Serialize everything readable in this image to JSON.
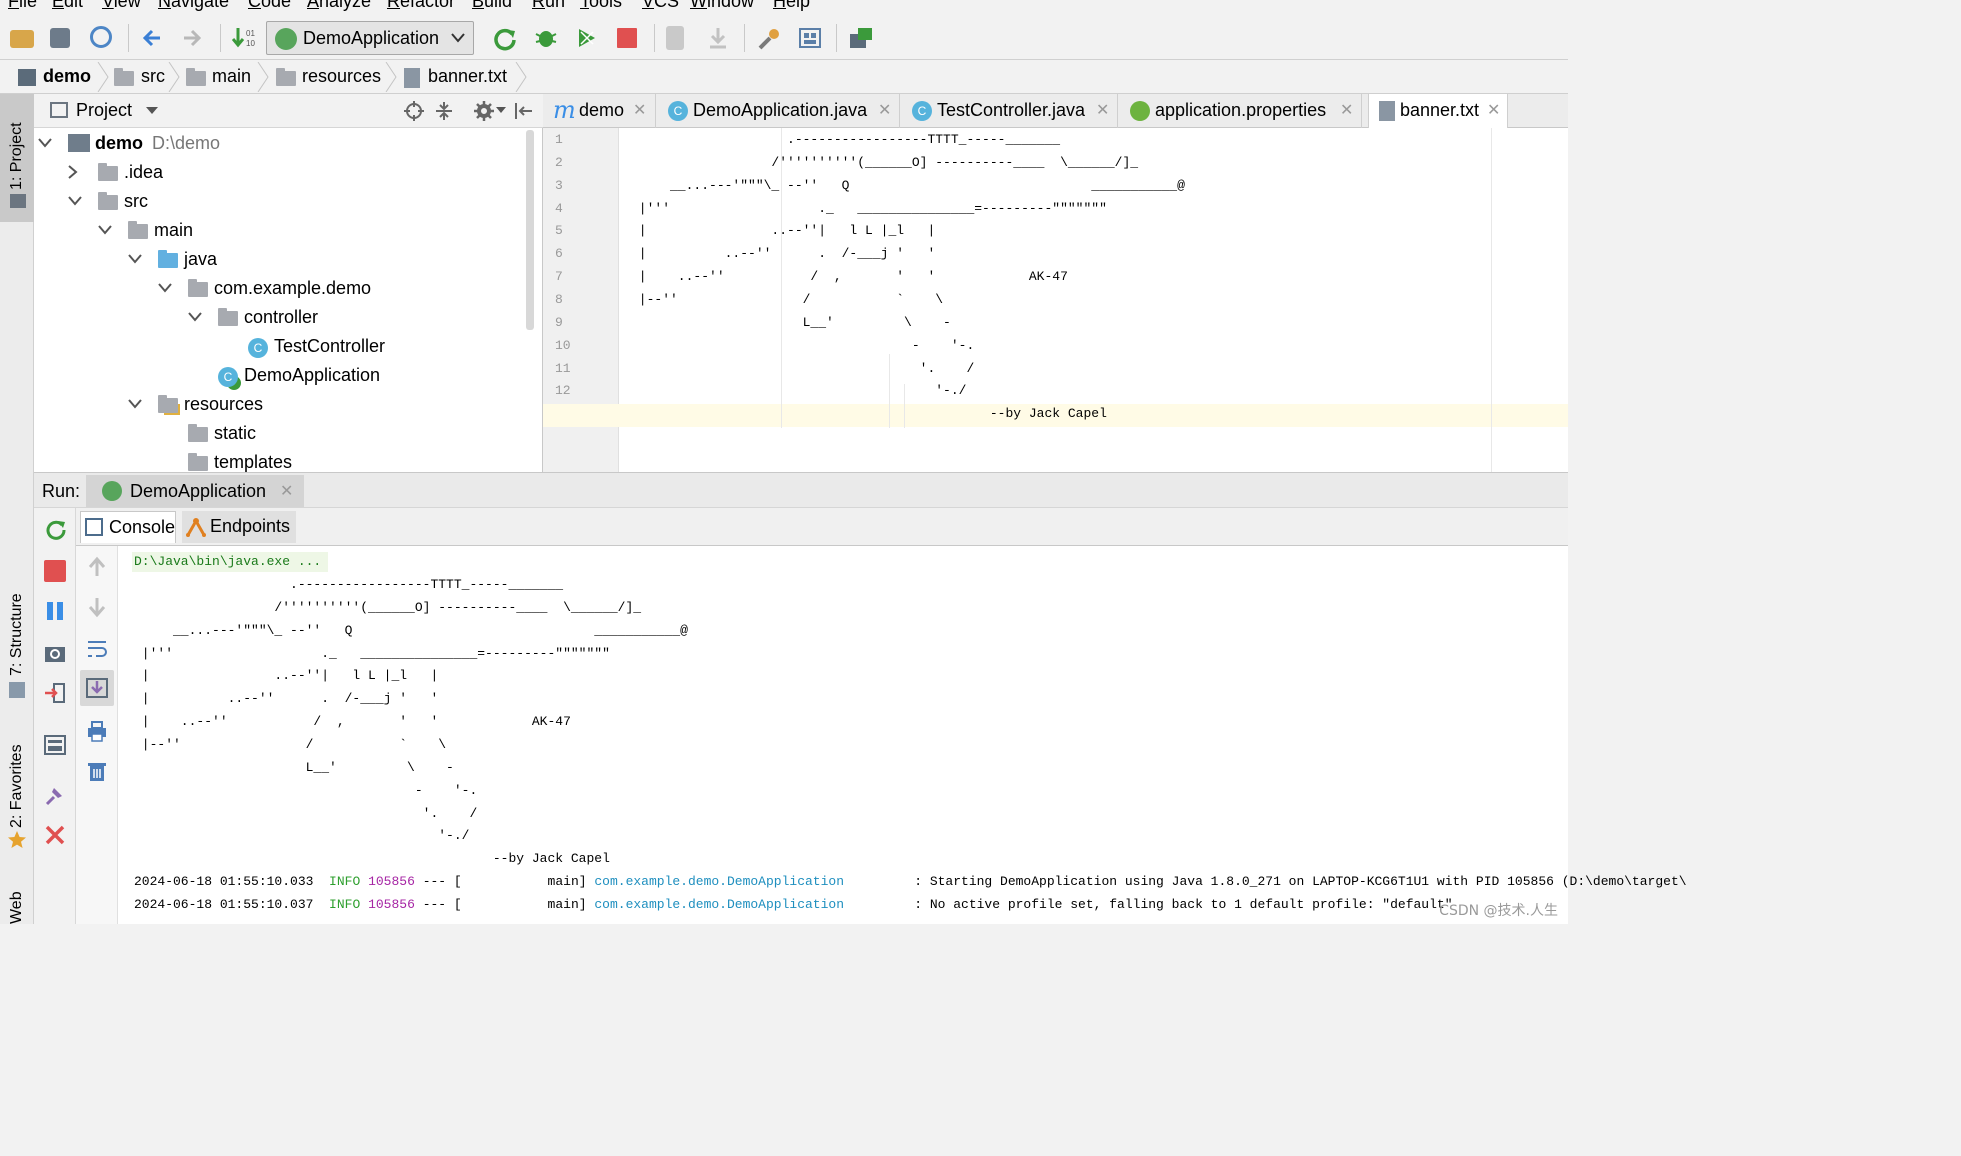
{
  "menu": [
    "File",
    "Edit",
    "View",
    "Navigate",
    "Code",
    "Analyze",
    "Refactor",
    "Build",
    "Run",
    "Tools",
    "VCS",
    "Window",
    "Help"
  ],
  "toolbar": {
    "run_config": "DemoApplication"
  },
  "breadcrumb": [
    "demo",
    "src",
    "main",
    "resources",
    "banner.txt"
  ],
  "left_strip": {
    "project_tab": "1: Project",
    "structure_tab": "7: Structure",
    "favorites_tab": "2: Favorites",
    "web_tab": "Web"
  },
  "project": {
    "title": "Project",
    "root": {
      "name": "demo",
      "path": "D:\\demo"
    },
    "items": [
      ".idea",
      "src",
      "main",
      "java",
      "com.example.demo",
      "controller",
      "TestController",
      "DemoApplication",
      "resources",
      "static",
      "templates"
    ]
  },
  "editor": {
    "tabs": [
      "demo",
      "DemoApplication.java",
      "TestController.java",
      "application.properties",
      "banner.txt"
    ],
    "active_tab": "banner.txt",
    "lines": [
      "                    .-----------------TTTT_-----_______",
      "                  /''''''''''(______O] ----------____  \\______/]_",
      "     __...---'\"\"\"\\_ --''   Q                               ___________@",
      " |'''                   ._   _______________=---------\"\"\"\"\"\"\"",
      " |                ..--''|   l L |_l   |",
      " |          ..--''      .  /-___j '   '",
      " |    ..--''           /  ,       '   '            AK-47",
      " |--''                /           `    \\",
      "                      L__'         \\    -",
      "                                    -    '-.",
      "                                     '.    /",
      "                                       '-./",
      "                                              --by Jack Capel"
    ]
  },
  "run": {
    "label": "Run:",
    "config_tab": "DemoApplication",
    "console_tab": "Console",
    "endpoints_tab": "Endpoints",
    "command": "D:\\Java\\bin\\java.exe ...",
    "banner": [
      "                    .-----------------TTTT_-----_______",
      "                  /''''''''''(______O] ----------____  \\______/]_",
      "     __...---'\"\"\"\\_ --''   Q                               ___________@",
      " |'''                   ._   _______________=---------\"\"\"\"\"\"\"",
      " |                ..--''|   l L |_l   |",
      " |          ..--''      .  /-___j '   '",
      " |    ..--''           /  ,       '   '            AK-47",
      " |--''                /           `    \\",
      "                      L__'         \\    -",
      "                                    -    '-.",
      "                                     '.    /",
      "                                       '-./",
      "                                              --by Jack Capel"
    ],
    "logs": [
      {
        "time": "2024-06-18 01:55:10.033",
        "level": "INFO",
        "pid": "105856",
        "thread": "[           main]",
        "logger": "com.example.demo.DemoApplication",
        "msg": ": Starting DemoApplication using Java 1.8.0_271 on LAPTOP-KCG6T1U1 with PID 105856 (D:\\demo\\target\\"
      },
      {
        "time": "2024-06-18 01:55:10.037",
        "level": "INFO",
        "pid": "105856",
        "thread": "[           main]",
        "logger": "com.example.demo.DemoApplication",
        "msg": ": No active profile set, falling back to 1 default profile: \"default\""
      }
    ]
  },
  "watermark": "CSDN @技术.人生",
  "colors": {
    "info": "#2d9f2d",
    "pid": "#a625a4",
    "logger": "#1f8fbf",
    "current_line": "#fffbe6",
    "accent_run": "#3b9a3b",
    "stop": "#e05050"
  }
}
